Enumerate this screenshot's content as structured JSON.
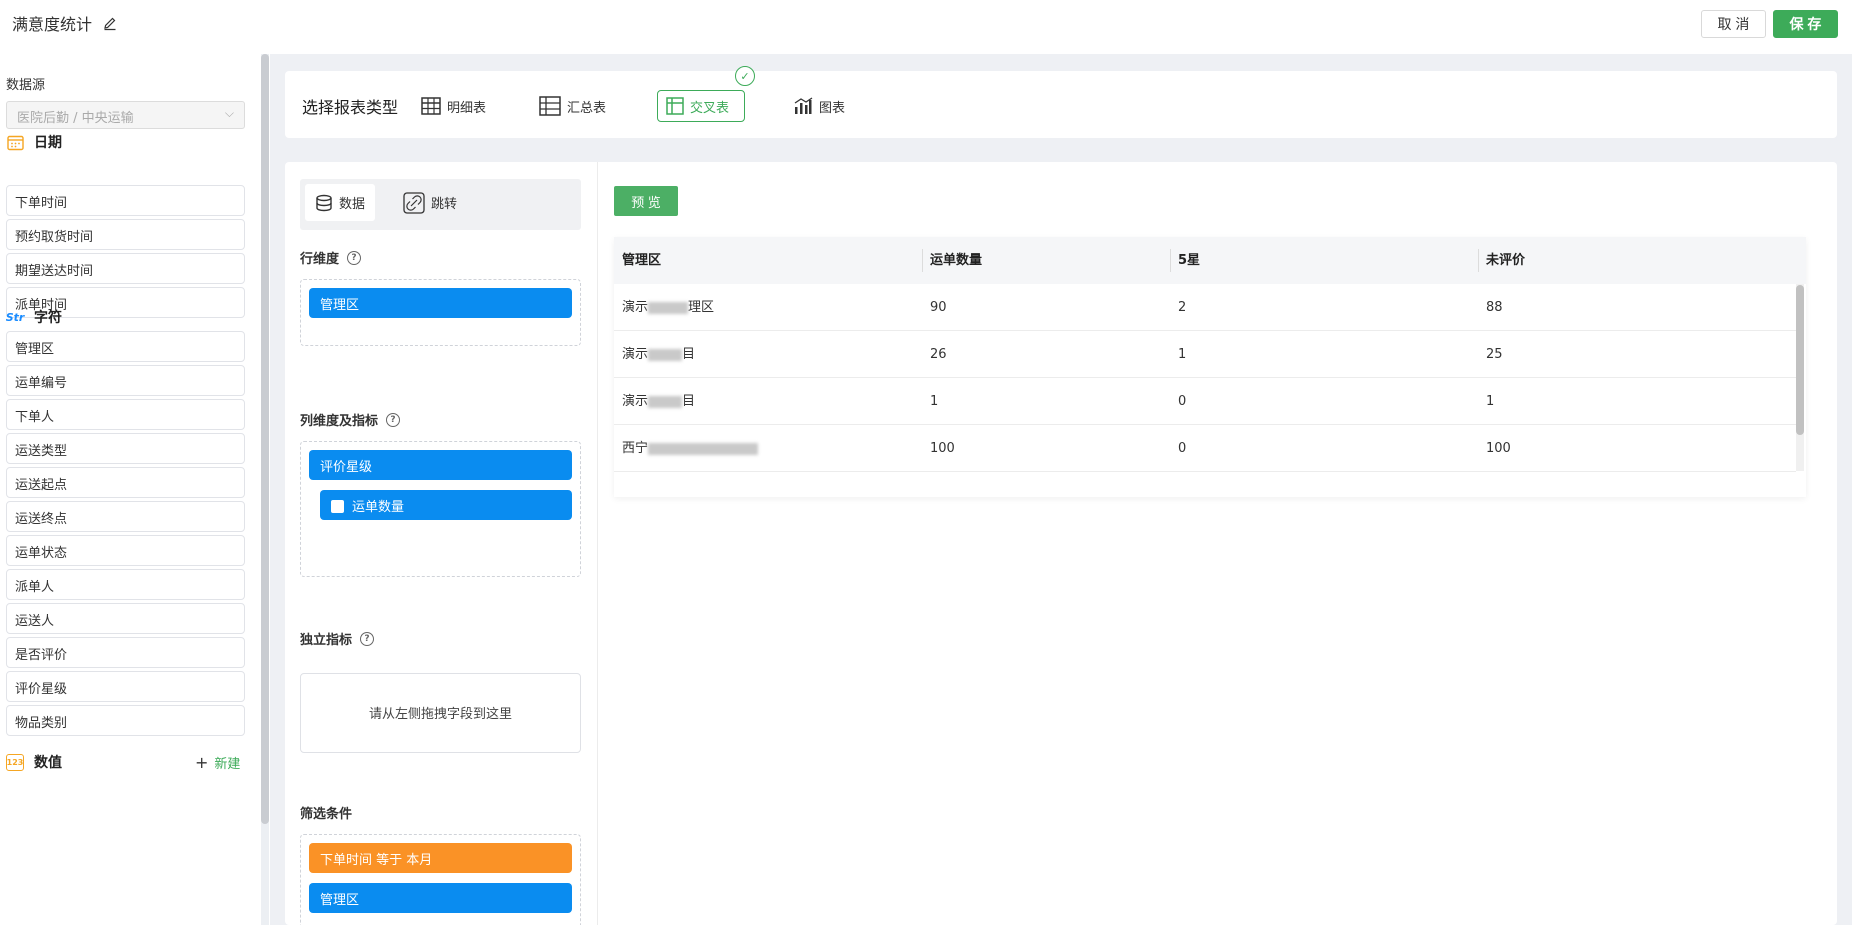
{
  "header": {
    "title": "满意度统计",
    "cancel_label": "取 消",
    "save_label": "保 存"
  },
  "sidebar": {
    "datasource_label": "数据源",
    "datasource_value": "医院后勤 / 中央运输",
    "groups": {
      "date": {
        "label": "日期",
        "icon": "calendar-icon",
        "items": [
          "下单时间",
          "预约取货时间",
          "期望送达时间",
          "派单时间"
        ]
      },
      "string": {
        "label": "字符",
        "icon": "Str",
        "items": [
          "管理区",
          "运单编号",
          "下单人",
          "运送类型",
          "运送起点",
          "运送终点",
          "运单状态",
          "派单人",
          "运送人",
          "是否评价",
          "评价星级",
          "物品类别"
        ]
      },
      "number": {
        "label": "数值",
        "icon": "123",
        "new_label": "新建"
      }
    }
  },
  "report_type": {
    "title": "选择报表类型",
    "options": [
      {
        "label": "明细表",
        "icon": "table-icon"
      },
      {
        "label": "汇总表",
        "icon": "summary-table-icon"
      },
      {
        "label": "交叉表",
        "icon": "cross-table-icon",
        "selected": true
      },
      {
        "label": "图表",
        "icon": "chart-icon"
      }
    ]
  },
  "config": {
    "tabs": [
      {
        "label": "数据",
        "icon": "database-icon",
        "active": true
      },
      {
        "label": "跳转",
        "icon": "link-icon"
      }
    ],
    "row_dim_label": "行维度",
    "row_dim_chips": [
      "管理区"
    ],
    "col_dim_label": "列维度及指标",
    "col_dim_chips": [
      "评价星级",
      "运单数量"
    ],
    "indep_label": "独立指标",
    "indep_hint": "请从左侧拖拽字段到这里",
    "filter_label": "筛选条件",
    "filter_chips": [
      "下单时间 等于 本月",
      "管理区"
    ]
  },
  "preview": {
    "button_label": "预 览",
    "columns": [
      "管理区",
      "运单数量",
      "5星",
      "未评价"
    ],
    "rows": [
      {
        "area_prefix": "演示",
        "area_suffix": "理区",
        "count": "90",
        "five_star": "2",
        "unrated": "88"
      },
      {
        "area_prefix": "演示",
        "area_suffix": "目",
        "count": "26",
        "five_star": "1",
        "unrated": "25"
      },
      {
        "area_prefix": "演示",
        "area_suffix": "目",
        "count": "1",
        "five_star": "0",
        "unrated": "1"
      },
      {
        "area_prefix": "西宁",
        "area_suffix": "",
        "count": "100",
        "five_star": "0",
        "unrated": "100"
      }
    ]
  },
  "colors": {
    "primary_green": "#3dab59",
    "chip_blue": "#0a8cf0",
    "chip_orange": "#fa9226"
  }
}
